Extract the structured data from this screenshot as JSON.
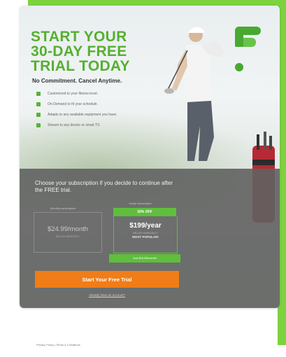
{
  "hero": {
    "title_line1": "START YOUR",
    "title_line2": "30-DAY FREE",
    "title_line3": "TRIAL TODAY",
    "subtitle": "No Commitment. Cancel Anytime."
  },
  "features": [
    {
      "icon": "target-icon",
      "text": "Customized to your fitness level."
    },
    {
      "icon": "calendar-icon",
      "text": "On-Demand to fit your schedule."
    },
    {
      "icon": "dumbbell-icon",
      "text": "Adapts to any available equipment you have."
    },
    {
      "icon": "tv-icon",
      "text": "Stream to any device or smart TV."
    }
  ],
  "subscription": {
    "prompt": "Choose your subscription if you decide to continue after the FREE trial.",
    "monthly": {
      "label": "Monthly subscription",
      "price": "$24.99/month",
      "billing": "BILLED MONTHLY"
    },
    "yearly": {
      "label": "Yearly subscription",
      "badge": "30% OFF",
      "price": "$199/year",
      "billing": "BILLED ANNUALLY",
      "popular": "MOST POPULAR!",
      "savings": "Just $16.58/month!"
    },
    "cta": "Start Your Free Trial",
    "account_link": "Already have an account?"
  },
  "footer": {
    "text": "Privacy Policy  |  Terms & Conditions"
  },
  "colors": {
    "brand_green": "#55b030",
    "cta_orange": "#f07d18",
    "panel_gray": "#606260"
  }
}
